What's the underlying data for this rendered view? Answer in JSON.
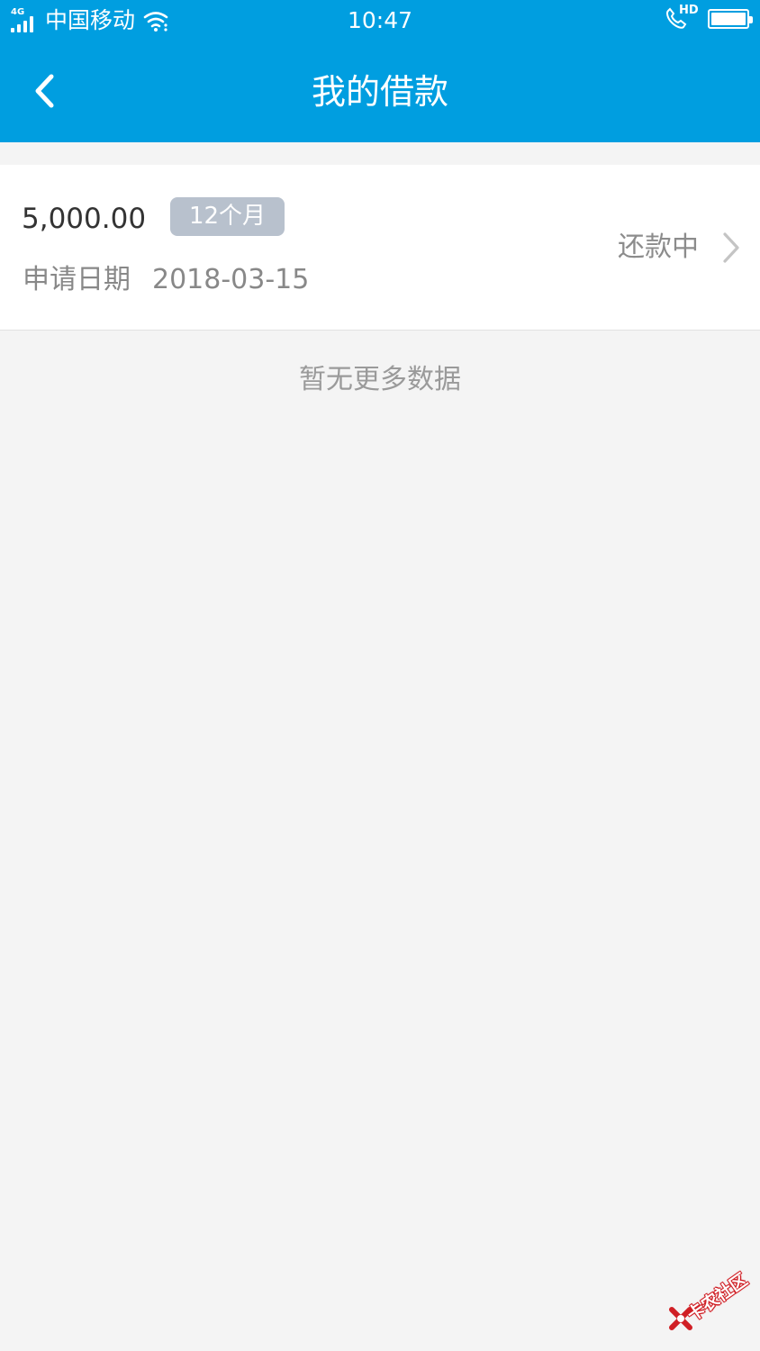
{
  "status_bar": {
    "network": "4G",
    "carrier": "中国移动",
    "time": "10:47",
    "call_badge": "HD",
    "battery_level": 1.0,
    "icons": [
      "signal-icon",
      "wifi-icon",
      "hd-call-icon",
      "battery-icon"
    ]
  },
  "header": {
    "title": "我的借款",
    "back_icon": "chevron-left-icon"
  },
  "loans": [
    {
      "amount": "5,000.00",
      "term": "12个月",
      "date_label": "申请日期",
      "date": "2018-03-15",
      "status": "还款中",
      "arrow_icon": "chevron-right-icon"
    }
  ],
  "list_footer": "暂无更多数据",
  "watermark": {
    "text": "卡农社区",
    "logo_icon": "kanong-logo"
  },
  "colors": {
    "primary": "#009ee0",
    "page_bg": "#f4f4f4",
    "card_bg": "#ffffff",
    "badge_bg": "#b8c1cd",
    "amount_text": "#333333",
    "secondary_text": "#888888",
    "watermark_red": "#d01f25"
  }
}
